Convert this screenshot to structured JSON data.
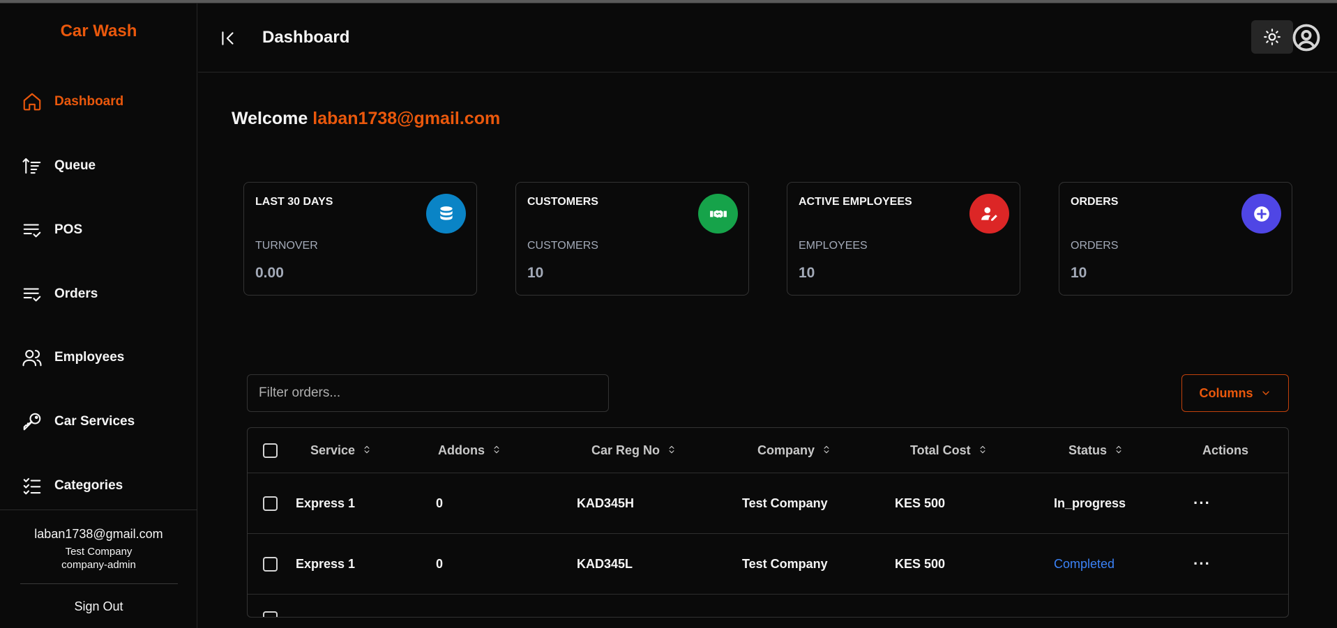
{
  "app": {
    "brand": "Car Wash",
    "accent": "#ea580c"
  },
  "sidebar": {
    "items": [
      {
        "label": "Dashboard",
        "icon": "home-icon",
        "active": true
      },
      {
        "label": "Queue",
        "icon": "sort-up-icon"
      },
      {
        "label": "POS",
        "icon": "list-check-icon"
      },
      {
        "label": "Orders",
        "icon": "list-check-icon"
      },
      {
        "label": "Employees",
        "icon": "users-icon"
      },
      {
        "label": "Car Services",
        "icon": "key-icon"
      },
      {
        "label": "Categories",
        "icon": "checklist-icon"
      }
    ],
    "user": {
      "email": "laban1738@gmail.com",
      "company": "Test Company",
      "role": "company-admin"
    },
    "sign_out": "Sign Out"
  },
  "header": {
    "title": "Dashboard"
  },
  "welcome": {
    "prefix": "Welcome",
    "email": "laban1738@gmail.com"
  },
  "cards": [
    {
      "title": "LAST 30 DAYS",
      "subtitle": "TURNOVER",
      "value": "0.00",
      "icon": "database-icon",
      "color": "#0a84c6"
    },
    {
      "title": "CUSTOMERS",
      "subtitle": "CUSTOMERS",
      "value": "10",
      "icon": "handshake-icon",
      "color": "#16a34a"
    },
    {
      "title": "ACTIVE EMPLOYEES",
      "subtitle": "EMPLOYEES",
      "value": "10",
      "icon": "user-edit-icon",
      "color": "#dc2626"
    },
    {
      "title": "ORDERS",
      "subtitle": "ORDERS",
      "value": "10",
      "icon": "plus-circle-icon",
      "color": "#4f46e5"
    }
  ],
  "filter": {
    "placeholder": "Filter orders..."
  },
  "columns_button": "Columns",
  "table": {
    "headers": [
      "Service",
      "Addons",
      "Car Reg No",
      "Company",
      "Total Cost",
      "Status",
      "Actions"
    ],
    "rows": [
      {
        "service": "Express 1",
        "addons": "0",
        "reg": "KAD345H",
        "company": "Test Company",
        "cost": "KES 500",
        "status": "In_progress",
        "actions": "···"
      },
      {
        "service": "Express 1",
        "addons": "0",
        "reg": "KAD345L",
        "company": "Test Company",
        "cost": "KES 500",
        "status": "Completed",
        "actions": "···"
      }
    ]
  }
}
